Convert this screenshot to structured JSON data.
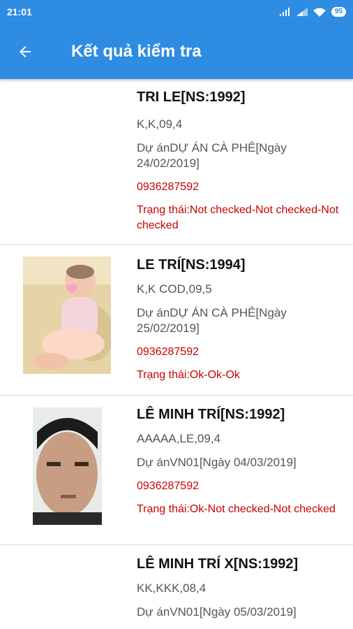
{
  "status_bar": {
    "time": "21:01",
    "battery": "95"
  },
  "app_bar": {
    "title": "Kết quả kiểm tra"
  },
  "items": [
    {
      "name": "TRI LE[NS:1992]",
      "code": "K,K,09,4",
      "project": "Dự ánDỰ ÁN CÀ PHÊ[Ngày 24/02/2019]",
      "phone": "0936287592",
      "status": "Trạng thái:Not checked-Not checked-Not checked"
    },
    {
      "name": "LE TRÍ[NS:1994]",
      "code": "K,K COD,09,5",
      "project": "Dự ánDỰ ÁN CÀ PHÊ[Ngày 25/02/2019]",
      "phone": "0936287592",
      "status": "Trạng thái:Ok-Ok-Ok"
    },
    {
      "name": "LÊ MINH TRÍ[NS:1992]",
      "code": "AAAAA,LE,09,4",
      "project": "Dự ánVN01[Ngày 04/03/2019]",
      "phone": "0936287592",
      "status": "Trạng thái:Ok-Not checked-Not checked"
    },
    {
      "name": "LÊ MINH TRÍ X[NS:1992]",
      "code": "KK,KKK,08,4",
      "project": "Dự ánVN01[Ngày 05/03/2019]"
    }
  ]
}
